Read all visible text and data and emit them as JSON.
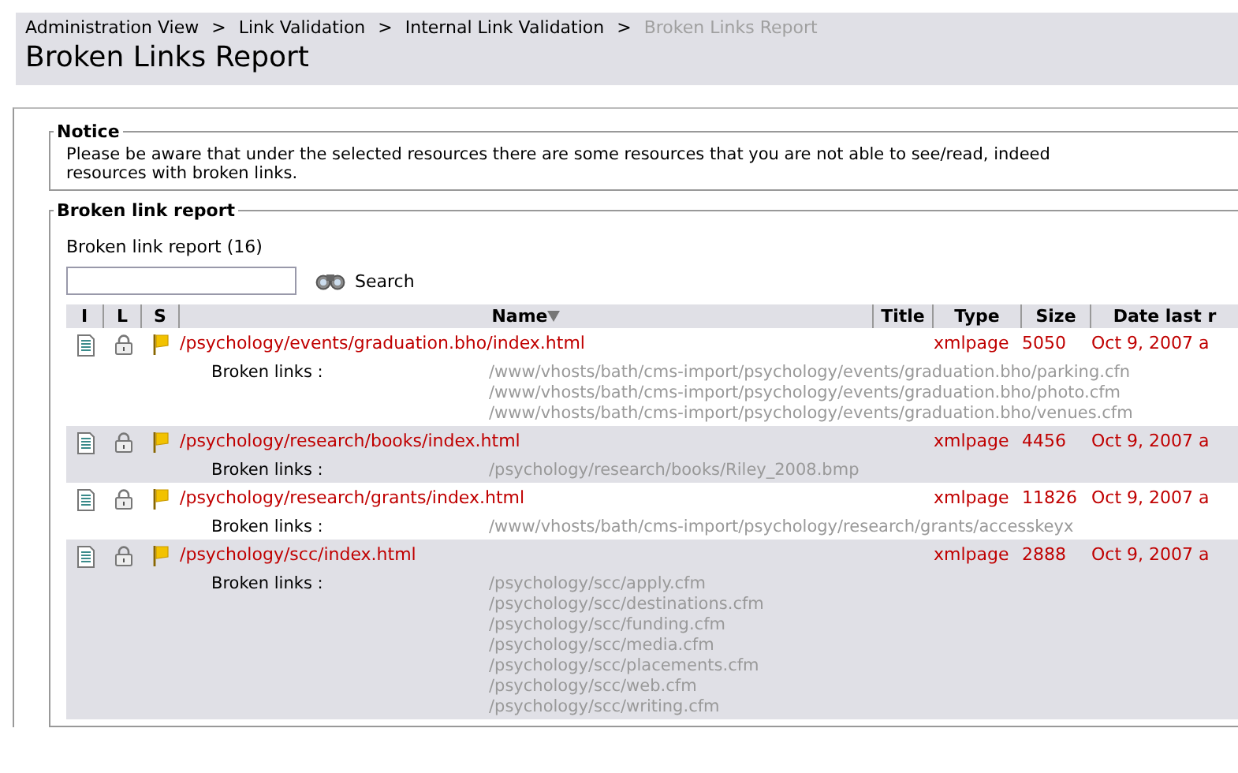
{
  "breadcrumbs": [
    {
      "label": "Administration View",
      "current": false
    },
    {
      "label": "Link Validation",
      "current": false
    },
    {
      "label": "Internal Link Validation",
      "current": false
    },
    {
      "label": "Broken Links Report",
      "current": true
    }
  ],
  "breadcrumb_separator": ">",
  "page_title": "Broken Links Report",
  "notice": {
    "legend": "Notice",
    "text": "Please be aware that under the selected resources there are some resources that you are not able to see/read, indeed\nresources with broken links."
  },
  "report": {
    "legend": "Broken link report",
    "count_label": "Broken link report (16)",
    "search": {
      "button": "Search"
    },
    "columns": [
      "I",
      "L",
      "S",
      "Name",
      "Title",
      "Type",
      "Size",
      "Date last r"
    ],
    "rows": [
      {
        "name": "/psychology/events/graduation.bho/index.html",
        "type": "xmlpage",
        "size": "5050",
        "date": "Oct 9, 2007 a",
        "links_label": "Broken links :",
        "links": [
          "/www/vhosts/bath/cms-import/psychology/events/graduation.bho/parking.cfn",
          "/www/vhosts/bath/cms-import/psychology/events/graduation.bho/photo.cfm",
          "/www/vhosts/bath/cms-import/psychology/events/graduation.bho/venues.cfm"
        ]
      },
      {
        "name": "/psychology/research/books/index.html",
        "type": "xmlpage",
        "size": "4456",
        "date": "Oct 9, 2007 a",
        "links_label": "Broken links :",
        "links": [
          "/psychology/research/books/Riley_2008.bmp"
        ]
      },
      {
        "name": "/psychology/research/grants/index.html",
        "type": "xmlpage",
        "size": "11826",
        "date": "Oct 9, 2007 a",
        "links_label": "Broken links :",
        "links": [
          "/www/vhosts/bath/cms-import/psychology/research/grants/accesskeyx"
        ]
      },
      {
        "name": "/psychology/scc/index.html",
        "type": "xmlpage",
        "size": "2888",
        "date": "Oct 9, 2007 a",
        "links_label": "Broken links :",
        "links": [
          "/psychology/scc/apply.cfm",
          "/psychology/scc/destinations.cfm",
          "/psychology/scc/funding.cfm",
          "/psychology/scc/media.cfm",
          "/psychology/scc/placements.cfm",
          "/psychology/scc/web.cfm",
          "/psychology/scc/writing.cfm"
        ]
      }
    ]
  }
}
